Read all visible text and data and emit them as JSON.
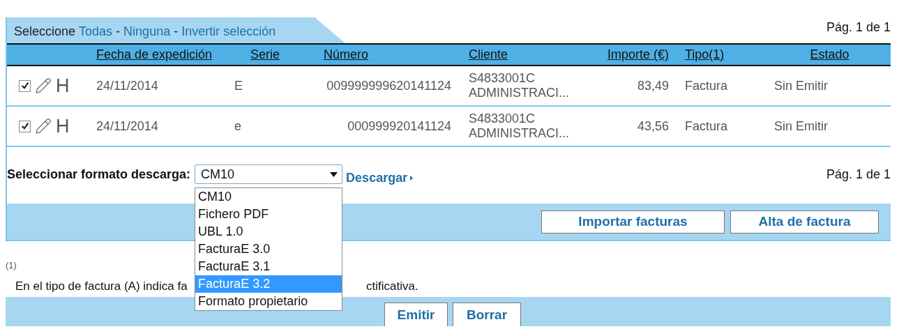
{
  "selection_bar": {
    "label": "Seleccione",
    "links": [
      "Todas",
      "Ninguna",
      "Invertir selección"
    ],
    "separator": "-"
  },
  "pagination_top": "Pág. 1 de 1",
  "table": {
    "columns": [
      {
        "label": "Fecha de expedición"
      },
      {
        "label": "Serie"
      },
      {
        "label": "Número"
      },
      {
        "label": "Cliente"
      },
      {
        "label": "Importe (€)"
      },
      {
        "label": "Tipo",
        "note": "(1)"
      },
      {
        "label": "Estado"
      }
    ],
    "rows": [
      {
        "checked": true,
        "history": "H",
        "fecha": "24/11/2014",
        "serie": "E",
        "numero": "009999999620141124",
        "cliente": [
          "S4833001C",
          "ADMINISTRACI..."
        ],
        "importe": "83,49",
        "tipo": "Factura",
        "estado": "Sin Emitir"
      },
      {
        "checked": true,
        "history": "H",
        "fecha": "24/11/2014",
        "serie": "e",
        "numero": "000999920141124",
        "cliente": [
          "S4833001C",
          "ADMINISTRACI..."
        ],
        "importe": "43,56",
        "tipo": "Factura",
        "estado": "Sin Emitir"
      }
    ]
  },
  "download": {
    "label": "Seleccionar formato descarga:",
    "value": "CM10",
    "expanded": true,
    "options": [
      {
        "label": "CM10",
        "highlighted": false
      },
      {
        "label": "Fichero PDF",
        "highlighted": false
      },
      {
        "label": "UBL 1.0",
        "highlighted": false
      },
      {
        "label": "FacturaE 3.0",
        "highlighted": false
      },
      {
        "label": "FacturaE 3.1",
        "highlighted": false
      },
      {
        "label": "FacturaE 3.2",
        "highlighted": true
      },
      {
        "label": "Formato propietario",
        "highlighted": false
      }
    ],
    "link": "Descargar"
  },
  "pagination_bottom": "Pág. 1 de 1",
  "action_buttons": [
    "Importar facturas",
    "Alta de factura"
  ],
  "footnote": {
    "mark": "(1)",
    "text_parts": [
      "En el tipo de factura (A) indica fa",
      "ctificativa."
    ]
  },
  "bottom_buttons": [
    "Emitir",
    "Borrar"
  ]
}
